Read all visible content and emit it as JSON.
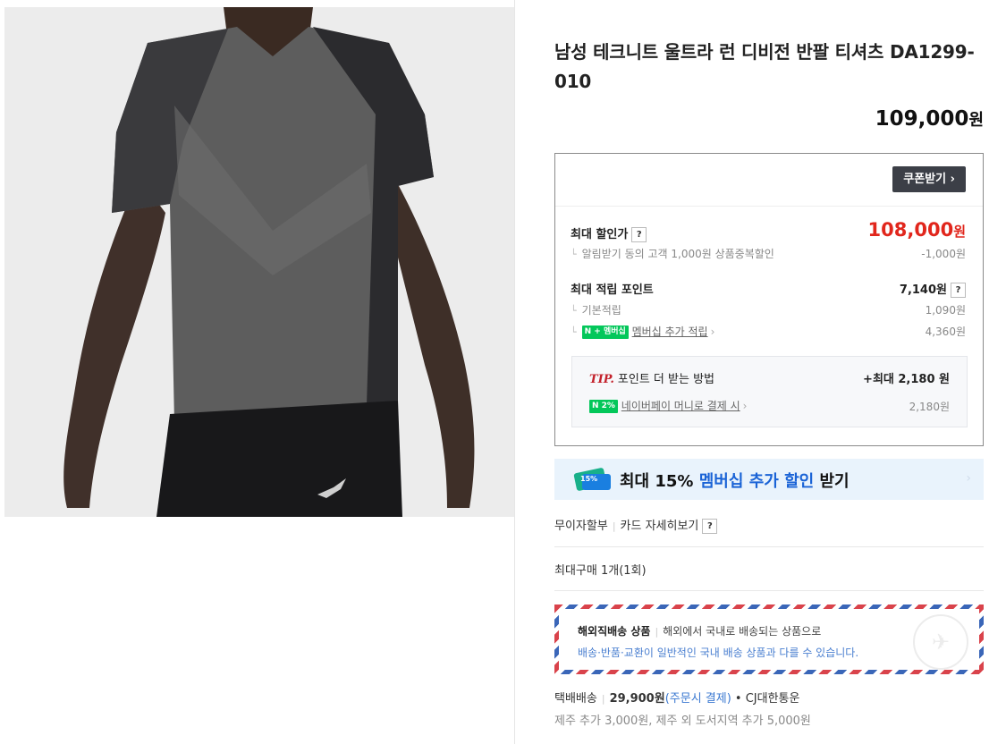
{
  "product": {
    "image_alt": "러닝 티셔츠 착용 모델",
    "title": "남성 테크니트 울트라 런 디비전 반팔 티셔츠 DA1299-010",
    "price": "109,000",
    "price_unit": "원"
  },
  "benefits": {
    "coupon_button": "쿠폰받기 ›",
    "max_discount_label": "최대 할인가",
    "max_discount_price": "108,000",
    "price_unit": "원",
    "alarm_label": "알림받기 동의 고객 1,000원 상품중복할인",
    "alarm_value": "-1,000원",
    "max_point_label": "최대 적립 포인트",
    "max_point_value": "7,140원",
    "basic_point_label": "기본적립",
    "basic_point_value": "1,090원",
    "membership_badge": "N + 멤버십",
    "membership_point_label": "멤버십 추가 적립",
    "membership_point_value": "4,360원",
    "help_mark": "?",
    "tip_prefix": "TIP.",
    "tip_label": "포인트 더 받는 방법",
    "tip_value": "+최대 2,180 원",
    "npay_badge": "N 2%",
    "npay_label": "네이버페이 머니로 결제 시",
    "npay_value": "2,180원"
  },
  "member_banner": {
    "text_prefix": "최대 15% ",
    "text_blue": "멤버십 추가 할인",
    "text_suffix": " 받기",
    "ticket_label": "15%"
  },
  "payment": {
    "installment": "무이자할부",
    "card_detail": "카드 자세히보기",
    "max_purchase": "최대구매 1개(1회)"
  },
  "overseas": {
    "title": "해외직배송 상품",
    "desc": "해외에서 국내로 배송되는 상품으로",
    "note": "배송·반품·교환이 일반적인 국내 배송 상품과 다를 수 있습니다."
  },
  "shipping": {
    "method": "택배배송",
    "fee": "29,900원",
    "fee_note": "(주문시 결제)",
    "carrier": "• CJ대한통운",
    "extra": "제주 추가 3,000원, 제주 외 도서지역 추가 5,000원"
  }
}
